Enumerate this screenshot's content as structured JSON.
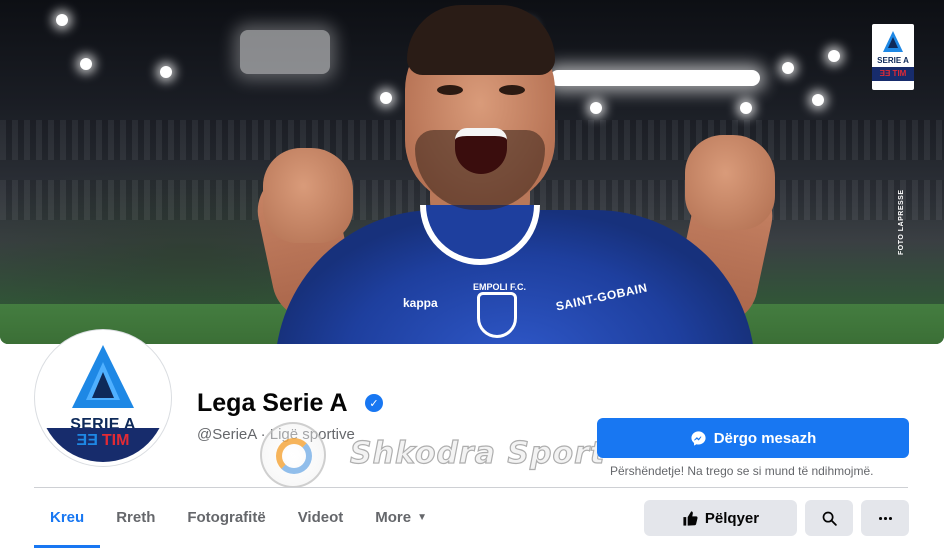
{
  "cover": {
    "photo_credit": "FOTO LAPRESSE",
    "jersey_brand": "kappa",
    "jersey_sponsor": "SAINT-GOBAIN",
    "jersey_badge": "EMPOLI F.C.",
    "flag_logo_text": "SERIE A",
    "flag_tim_text": "ƎƎ TIM"
  },
  "avatar": {
    "brand_text": "SERIE A",
    "tim_mark": "ƎƎ",
    "tim_word": "TIM"
  },
  "profile": {
    "name": "Lega Serie A",
    "verified": true,
    "handle_and_category": "@SerieA · Ligë sportive"
  },
  "watermark": {
    "text": "Shkodra Sport"
  },
  "actions": {
    "message_label": "Dërgo mesazh",
    "greeting": "Përshëndetje! Na trego se si mund të ndihmojmë.",
    "like_label": "Pëlqyer"
  },
  "tabs": [
    {
      "label": "Kreu",
      "active": true
    },
    {
      "label": "Rreth",
      "active": false
    },
    {
      "label": "Fotografitë",
      "active": false
    },
    {
      "label": "Videot",
      "active": false
    },
    {
      "label": "More",
      "active": false
    }
  ],
  "colors": {
    "accent": "#1877f2",
    "secondary_button": "#e4e6eb",
    "muted_text": "#65676b",
    "jersey_blue": "#1e3f9e",
    "tim_red": "#e12a35"
  }
}
